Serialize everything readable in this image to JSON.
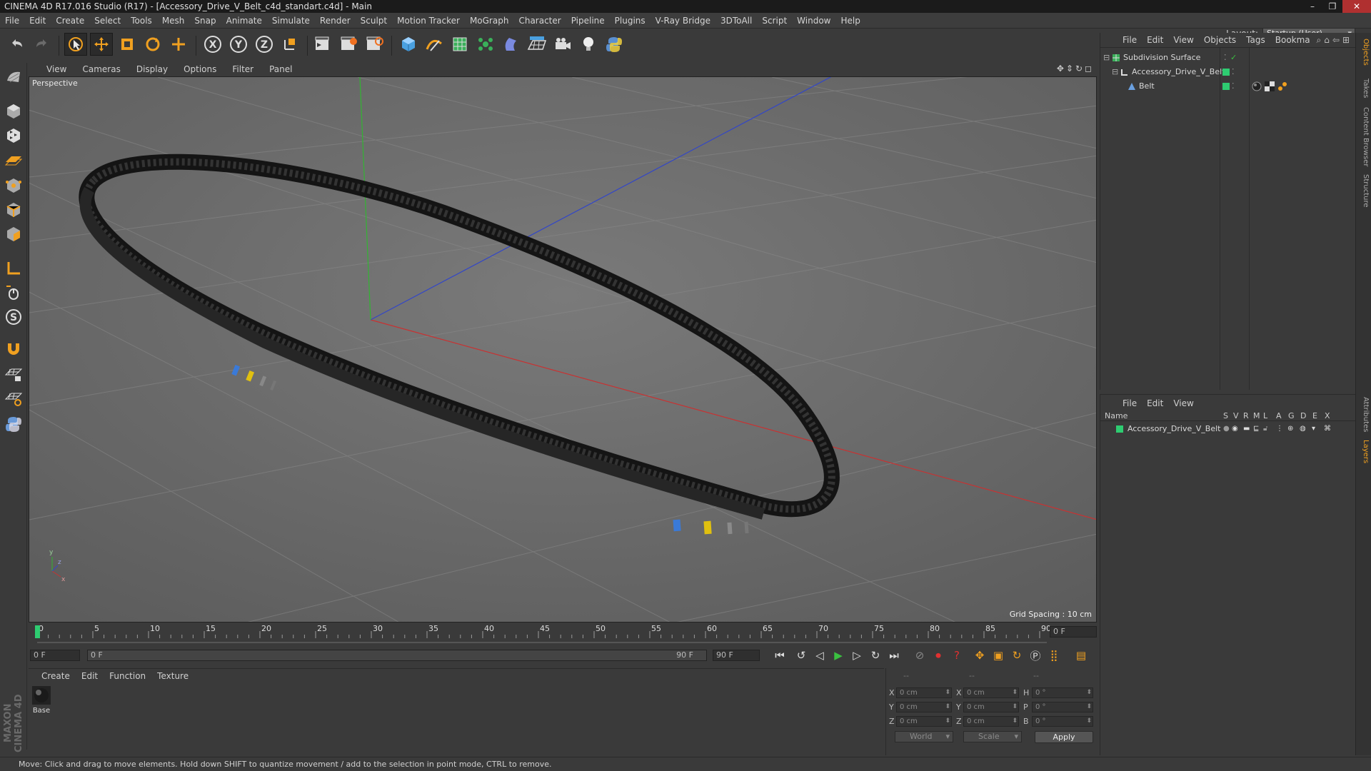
{
  "window": {
    "title": "CINEMA 4D R17.016 Studio (R17) - [Accessory_Drive_V_Belt_c4d_standart.c4d] - Main",
    "buttons": [
      "–",
      "❐",
      "✕"
    ]
  },
  "menubar": {
    "items": [
      "File",
      "Edit",
      "Create",
      "Select",
      "Tools",
      "Mesh",
      "Snap",
      "Animate",
      "Simulate",
      "Render",
      "Sculpt",
      "Motion Tracker",
      "MoGraph",
      "Character",
      "Pipeline",
      "Plugins",
      "V-Ray Bridge",
      "3DToAll",
      "Script",
      "Window",
      "Help"
    ],
    "layout_label": "Layout:",
    "layout_value": "Startup (User)"
  },
  "viewport": {
    "menu": [
      "View",
      "Cameras",
      "Display",
      "Options",
      "Filter",
      "Panel"
    ],
    "label": "Perspective",
    "grid_spacing": "Grid Spacing : 10 cm"
  },
  "timeline": {
    "ticks": [
      "0",
      "5",
      "10",
      "15",
      "20",
      "25",
      "30",
      "35",
      "40",
      "45",
      "50",
      "55",
      "60",
      "65",
      "70",
      "75",
      "80",
      "85",
      "90"
    ],
    "current_frame_field": "0 F",
    "start_field": "0 F",
    "range_start": "0 F",
    "range_end": "90 F",
    "end_field": "90 F"
  },
  "material_panel": {
    "menu": [
      "Create",
      "Edit",
      "Function",
      "Texture"
    ],
    "materials": [
      {
        "name": "Base"
      }
    ]
  },
  "coordinates": {
    "headers": [
      "--",
      "--",
      "--"
    ],
    "rows": [
      {
        "l1": "X",
        "v1": "0 cm",
        "l2": "X",
        "v2": "0 cm",
        "l3": "H",
        "v3": "0 °"
      },
      {
        "l1": "Y",
        "v1": "0 cm",
        "l2": "Y",
        "v2": "0 cm",
        "l3": "P",
        "v3": "0 °"
      },
      {
        "l1": "Z",
        "v1": "0 cm",
        "l2": "Z",
        "v2": "0 cm",
        "l3": "B",
        "v3": "0 °"
      }
    ],
    "space_select": "World",
    "mode_select": "Scale",
    "apply_label": "Apply"
  },
  "object_manager": {
    "menu": [
      "File",
      "Edit",
      "View",
      "Objects",
      "Tags",
      "Bookma"
    ],
    "objects": [
      {
        "name": "Subdivision Surface"
      },
      {
        "name": "Accessory_Drive_V_Belt"
      },
      {
        "name": "Belt"
      }
    ]
  },
  "layer_manager": {
    "menu": [
      "File",
      "Edit",
      "View"
    ],
    "name_header": "Name",
    "columns": [
      "S",
      "V",
      "R",
      "M",
      "L",
      "A",
      "G",
      "D",
      "E",
      "X"
    ],
    "layers": [
      {
        "name": "Accessory_Drive_V_Belt"
      }
    ]
  },
  "right_tabs": [
    "Objects",
    "Takes",
    "Content Browser",
    "Structure",
    "Attributes",
    "Layers"
  ],
  "status": {
    "text": "Move: Click and drag to move elements. Hold down SHIFT to quantize movement / add to the selection in point mode, CTRL to remove."
  },
  "branding": {
    "logo_text": "MAXON CINEMA 4D"
  },
  "colors": {
    "accent_orange": "#f0a020",
    "layer_green": "#2ecc71",
    "axis_red": "#c83232",
    "axis_green": "#32b432",
    "axis_blue": "#3246c8"
  }
}
